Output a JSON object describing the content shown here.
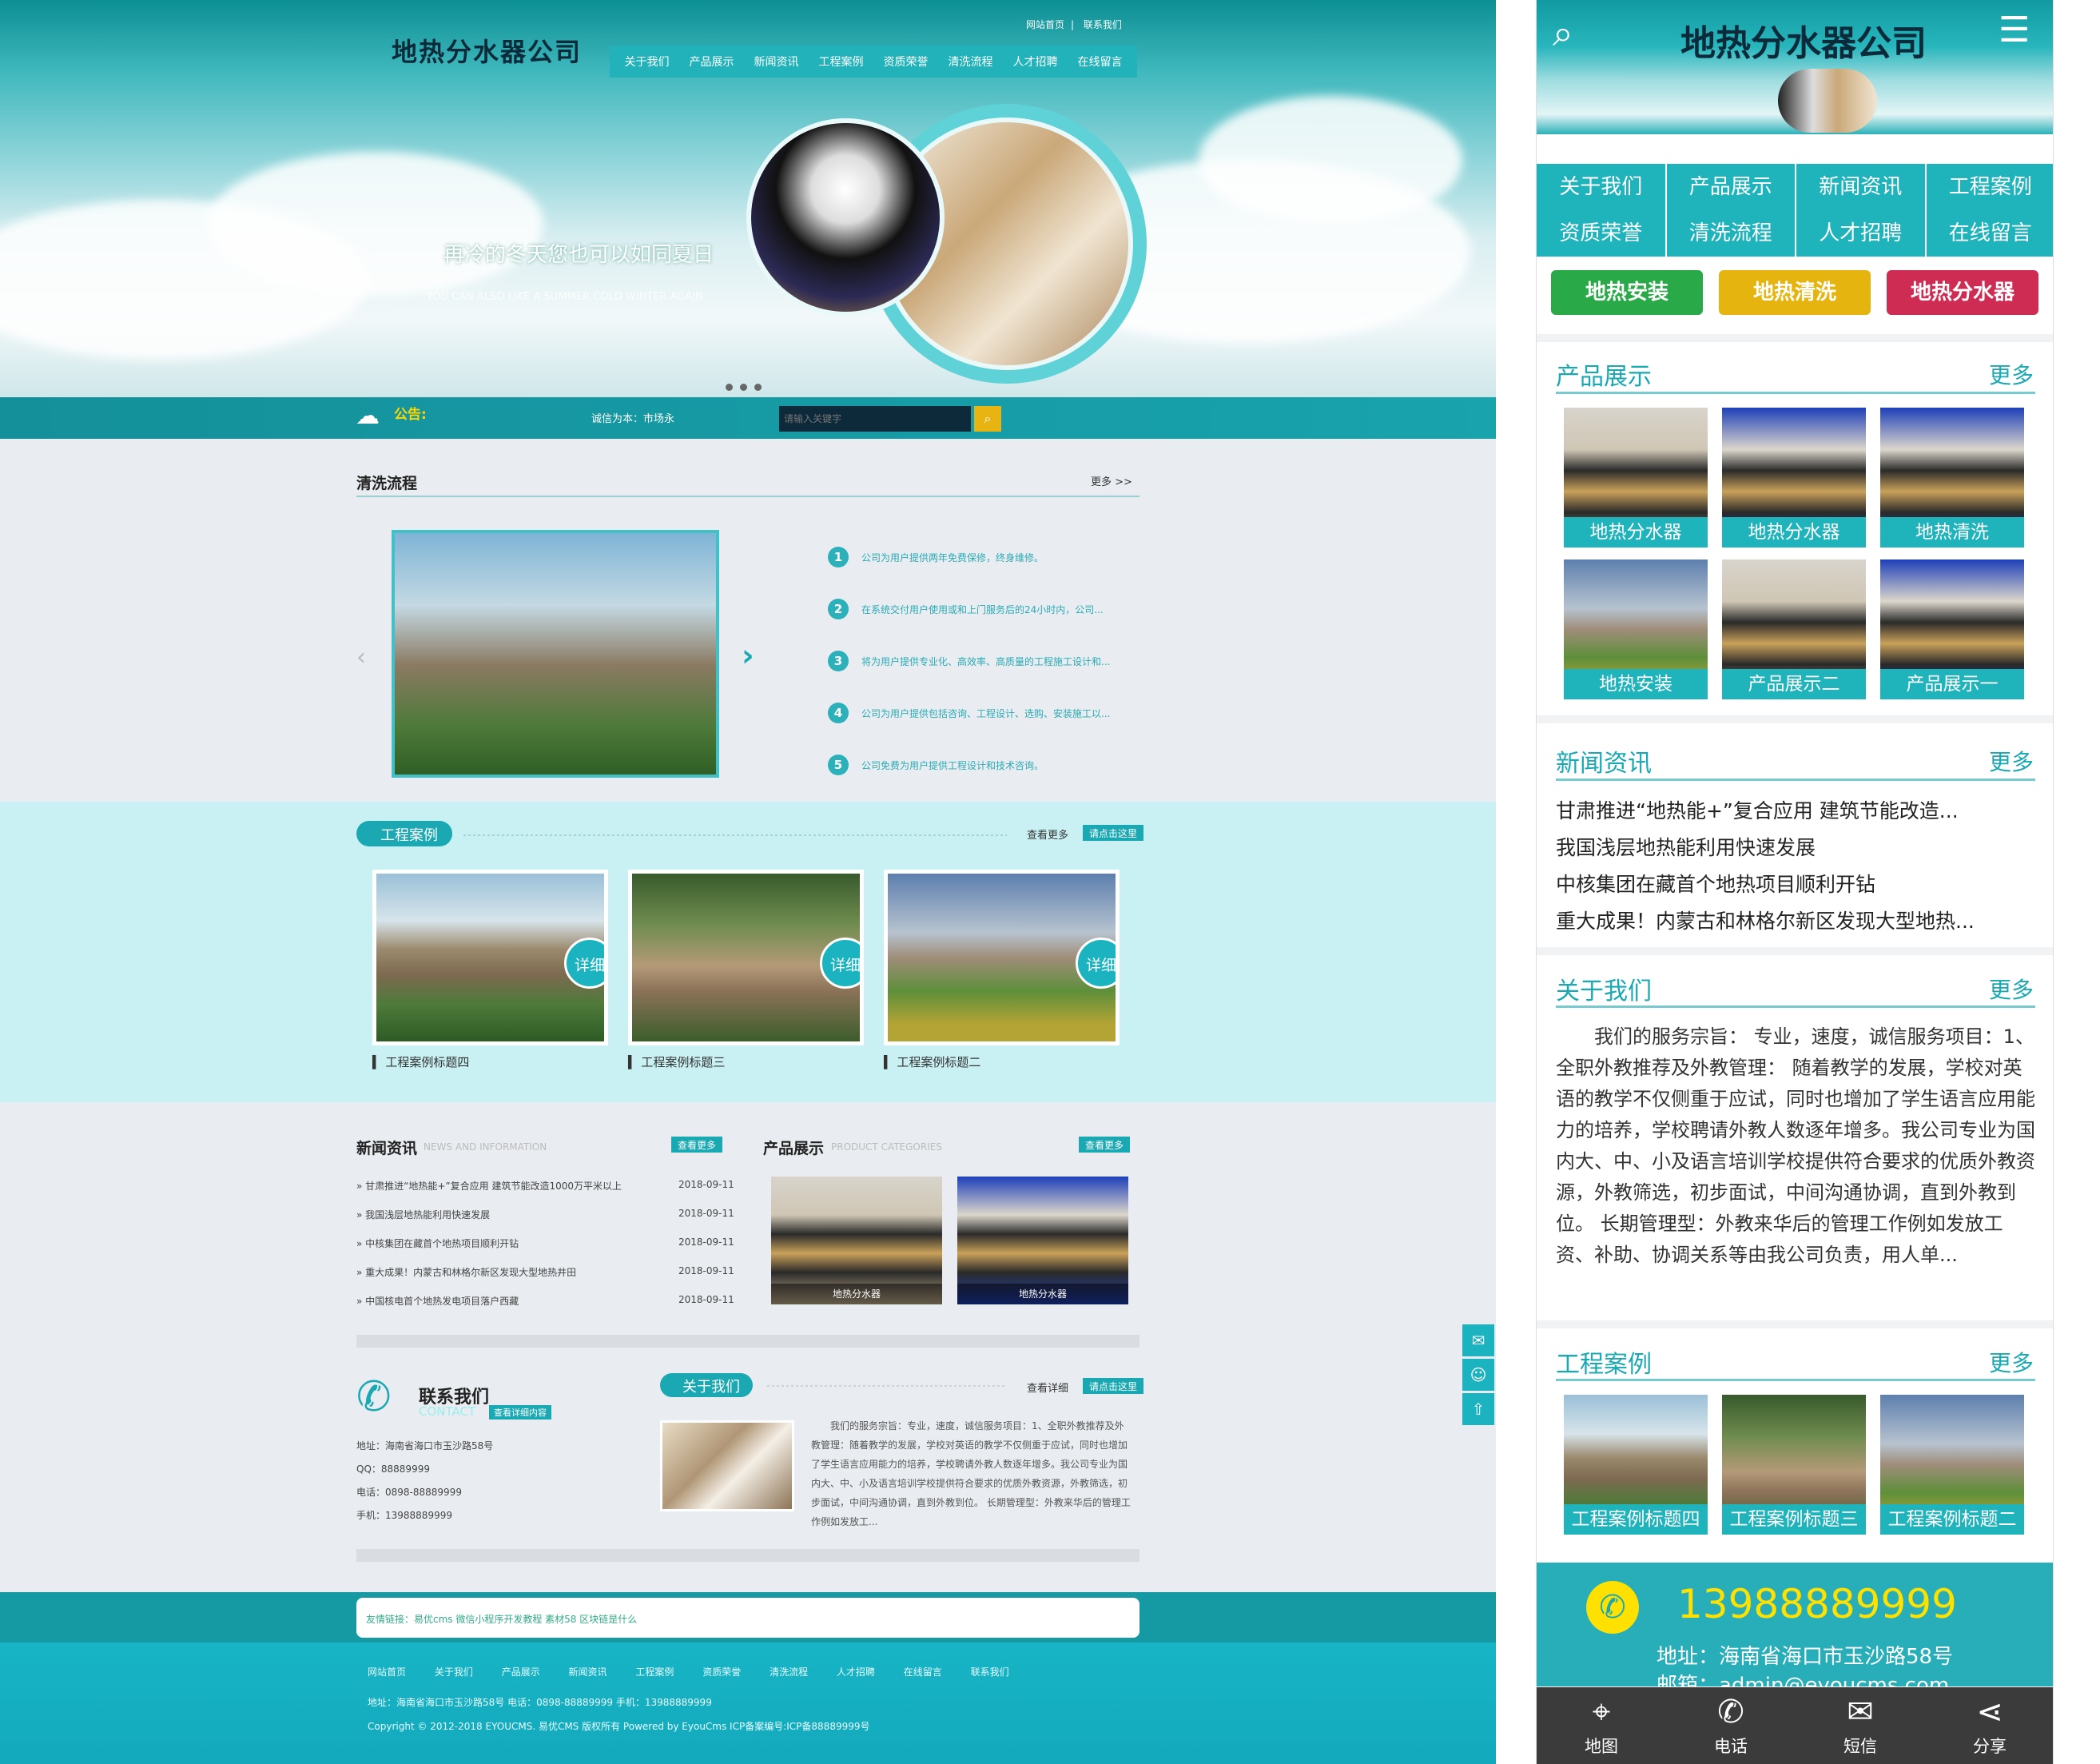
{
  "desktop": {
    "logo": "地热分水器公司",
    "top_links": [
      "网站首页",
      "联系我们"
    ],
    "nav": [
      "关于我们",
      "产品展示",
      "新闻资讯",
      "工程案例",
      "资质荣誉",
      "清洗流程",
      "人才招聘",
      "在线留言"
    ],
    "slogan": "再冷的冬天您也可以如同夏日",
    "slogan_en": "YOU CAN ALSO LIKE A SUMMER COLD WINTER AGAIN",
    "notice_label": "公告:",
    "notice_text": "诚信为本：市场永",
    "search_placeholder": "请输入关键字",
    "flow": {
      "title": "清洗流程",
      "more": "更多 >>",
      "items": [
        "公司为用户提供两年免费保修，终身维修。",
        "在系统交付用户使用或和上门服务后的24小时内，公司...",
        "将为用户提供专业化、高效率、高质量的工程施工设计和...",
        "公司为用户提供包括咨询、工程设计、选购、安装施工以...",
        "公司免费为用户提供工程设计和技术咨询。"
      ]
    },
    "cases": {
      "title": "工程案例",
      "more": "查看更多",
      "click": "请点击这里",
      "detail": "详细",
      "items": [
        "工程案例标题四",
        "工程案例标题三",
        "工程案例标题二"
      ]
    },
    "news": {
      "title": "新闻资讯",
      "sub": "NEWS AND INFORMATION",
      "more": "查看更多",
      "items": [
        {
          "t": "甘肃推进“地热能+”复合应用 建筑节能改造1000万平米以上",
          "d": "2018-09-11"
        },
        {
          "t": "我国浅层地热能利用快速发展",
          "d": "2018-09-11"
        },
        {
          "t": "中核集团在藏首个地热项目顺利开钻",
          "d": "2018-09-11"
        },
        {
          "t": "重大成果！内蒙古和林格尔新区发现大型地热井田",
          "d": "2018-09-11"
        },
        {
          "t": "中国核电首个地热发电项目落户西藏",
          "d": "2018-09-11"
        }
      ]
    },
    "products": {
      "title": "产品展示",
      "sub": "PRODUCT CATEGORIES",
      "more": "查看更多",
      "items": [
        "地热分水器",
        "地热分水器"
      ]
    },
    "contact": {
      "title": "联系我们",
      "sub": "CONTACT",
      "detail": "查看详细内容",
      "addr": "地址：海南省海口市玉沙路58号",
      "qq": "QQ：88889999",
      "tel": "电话：0898-88889999",
      "mobile": "手机：13988889999"
    },
    "about": {
      "title": "关于我们",
      "more": "查看详细",
      "click": "请点击这里",
      "text": "我们的服务宗旨：专业，速度，诚信服务项目：1、全职外教推荐及外教管理：随着教学的发展，学校对英语的教学不仅侧重于应试，同时也增加了学生语言应用能力的培养，学校聘请外教人数逐年增多。我公司专业为国内大、中、小及语言培训学校提供符合要求的优质外教资源，外教筛选，初步面试，中间沟通协调，直到外教到位。 长期管理型：外教来华后的管理工作例如发放工..."
    },
    "footer": {
      "links": "友情链接：易优cms   微信小程序开发教程   素材58   区块链是什么",
      "nav": [
        "网站首页",
        "关于我们",
        "产品展示",
        "新闻资讯",
        "工程案例",
        "资质荣誉",
        "清洗流程",
        "人才招聘",
        "在线留言",
        "联系我们"
      ],
      "addr": "地址：海南省海口市玉沙路58号     电话：0898-88889999   手机：13988889999",
      "copy": "Copyright © 2012-2018 EYOUCMS. 易优CMS 版权所有 Powered by EyouCms   ICP备案编号:ICP备88889999号"
    }
  },
  "mobile": {
    "logo": "地热分水器公司",
    "nav1": [
      "关于我们",
      "产品展示",
      "新闻资讯",
      "工程案例"
    ],
    "nav2": [
      "资质荣誉",
      "清洗流程",
      "人才招聘",
      "在线留言"
    ],
    "buttons": [
      {
        "label": "地热安装",
        "color": "#2aa948"
      },
      {
        "label": "地热清洗",
        "color": "#e5b40f"
      },
      {
        "label": "地热分水器",
        "color": "#cf2c54"
      }
    ],
    "more": "更多",
    "products_title": "产品展示",
    "products": [
      "地热分水器",
      "地热分水器",
      "地热清洗",
      "地热安装",
      "产品展示二",
      "产品展示一"
    ],
    "news_title": "新闻资讯",
    "news": [
      "甘肃推进“地热能+”复合应用 建筑节能改造...",
      "我国浅层地热能利用快速发展",
      "中核集团在藏首个地热项目顺利开钻",
      "重大成果！内蒙古和林格尔新区发现大型地热..."
    ],
    "about_title": "关于我们",
    "about_text": "我们的服务宗旨： 专业，速度，诚信服务项目：1、全职外教推荐及外教管理： 随着教学的发展，学校对英语的教学不仅侧重于应试，同时也增加了学生语言应用能力的培养，学校聘请外教人数逐年增多。我公司专业为国内大、中、小及语言培训学校提供符合要求的优质外教资源，外教筛选，初步面试，中间沟通协调，直到外教到位。 长期管理型：外教来华后的管理工作例如发放工资、补助、协调关系等由我公司负责，用人单...",
    "cases_title": "工程案例",
    "cases": [
      "工程案例标题四",
      "工程案例标题三",
      "工程案例标题二"
    ],
    "phone": "13988889999",
    "addr": "地址：海南省海口市玉沙路58号",
    "mail": "邮箱：admin@eyoucms.com",
    "bottom": [
      "地图",
      "电话",
      "短信",
      "分享"
    ]
  },
  "colors": {
    "accent": "#1aa8b2",
    "yellow": "#e7b411"
  }
}
